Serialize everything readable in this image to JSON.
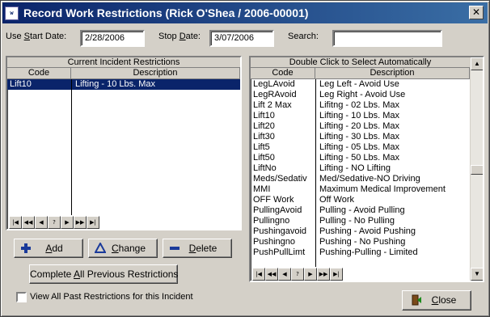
{
  "window": {
    "icon_text": "w",
    "title": "Record Work Restrictions (Rick O'Shea / 2006-00001)",
    "close_glyph": "✕"
  },
  "filters": {
    "start_label_pre": "Use ",
    "start_label_u": "S",
    "start_label_post": "tart Date:",
    "start_value": "2/28/2006",
    "stop_label_pre": "Stop ",
    "stop_label_u": "D",
    "stop_label_post": "ate:",
    "stop_value": "3/07/2006",
    "search_label": "Search:",
    "search_value": ""
  },
  "current": {
    "caption": "Current Incident Restrictions",
    "col_code": "Code",
    "col_desc": "Description",
    "rows": [
      {
        "code": "Lift10",
        "desc": "Lifting - 10 Lbs. Max",
        "selected": true
      }
    ]
  },
  "available": {
    "caption": "Double Click to Select Automatically",
    "col_code": "Code",
    "col_desc": "Description",
    "rows": [
      {
        "code": "LegLAvoid",
        "desc": "Leg Left  - Avoid Use"
      },
      {
        "code": "LegRAvoid",
        "desc": "Leg Right - Avoid Use"
      },
      {
        "code": "Lift 2 Max",
        "desc": "Lifitng - 02 Lbs. Max"
      },
      {
        "code": "Lift10",
        "desc": "Lifting - 10 Lbs. Max"
      },
      {
        "code": "Lift20",
        "desc": "Lifting - 20 Lbs. Max"
      },
      {
        "code": "Lift30",
        "desc": "Lifting - 30 Lbs. Max"
      },
      {
        "code": "Lift5",
        "desc": "Lifting - 05 Lbs. Max"
      },
      {
        "code": "Lift50",
        "desc": "Lifting - 50 Lbs. Max"
      },
      {
        "code": "LiftNo",
        "desc": "Lifting - NO Lifting"
      },
      {
        "code": "Meds/Sedativ",
        "desc": "Med/Sedative-NO Driving"
      },
      {
        "code": "MMI",
        "desc": "Maximum Medical Improvement"
      },
      {
        "code": "OFF Work",
        "desc": "Off Work"
      },
      {
        "code": "PullingAvoid",
        "desc": "Pulling - Avoid Pulling"
      },
      {
        "code": "Pullingno",
        "desc": "Pulling - No Pulling"
      },
      {
        "code": "Pushingavoid",
        "desc": "Pushing - Avoid Pushing"
      },
      {
        "code": "Pushingno",
        "desc": "Pushing - No Pushing"
      },
      {
        "code": "PushPullLimt",
        "desc": "Pushing-Pulling - Limited"
      }
    ]
  },
  "nav": {
    "first": "|◀",
    "prev_page": "◀◀",
    "prev": "◀",
    "find": "?",
    "next": "▶",
    "next_page": "▶▶",
    "last": "▶|"
  },
  "scrollbar": {
    "up": "▲",
    "down": "▼"
  },
  "buttons": {
    "add_u": "A",
    "add_rest": "dd",
    "change_u": "C",
    "change_rest": "hange",
    "delete_u": "D",
    "delete_rest": "elete",
    "complete_pre": "Complete ",
    "complete_u": "A",
    "complete_post": "ll Previous Restrictions",
    "close_u": "C",
    "close_rest": "lose"
  },
  "view_past": {
    "label": "View All Past Restrictions for this Incident",
    "checked": false
  },
  "colors": {
    "titlebar_start": "#0a246a",
    "titlebar_end": "#3a6ea5",
    "selection": "#0a246a",
    "face": "#d4d0c8"
  }
}
